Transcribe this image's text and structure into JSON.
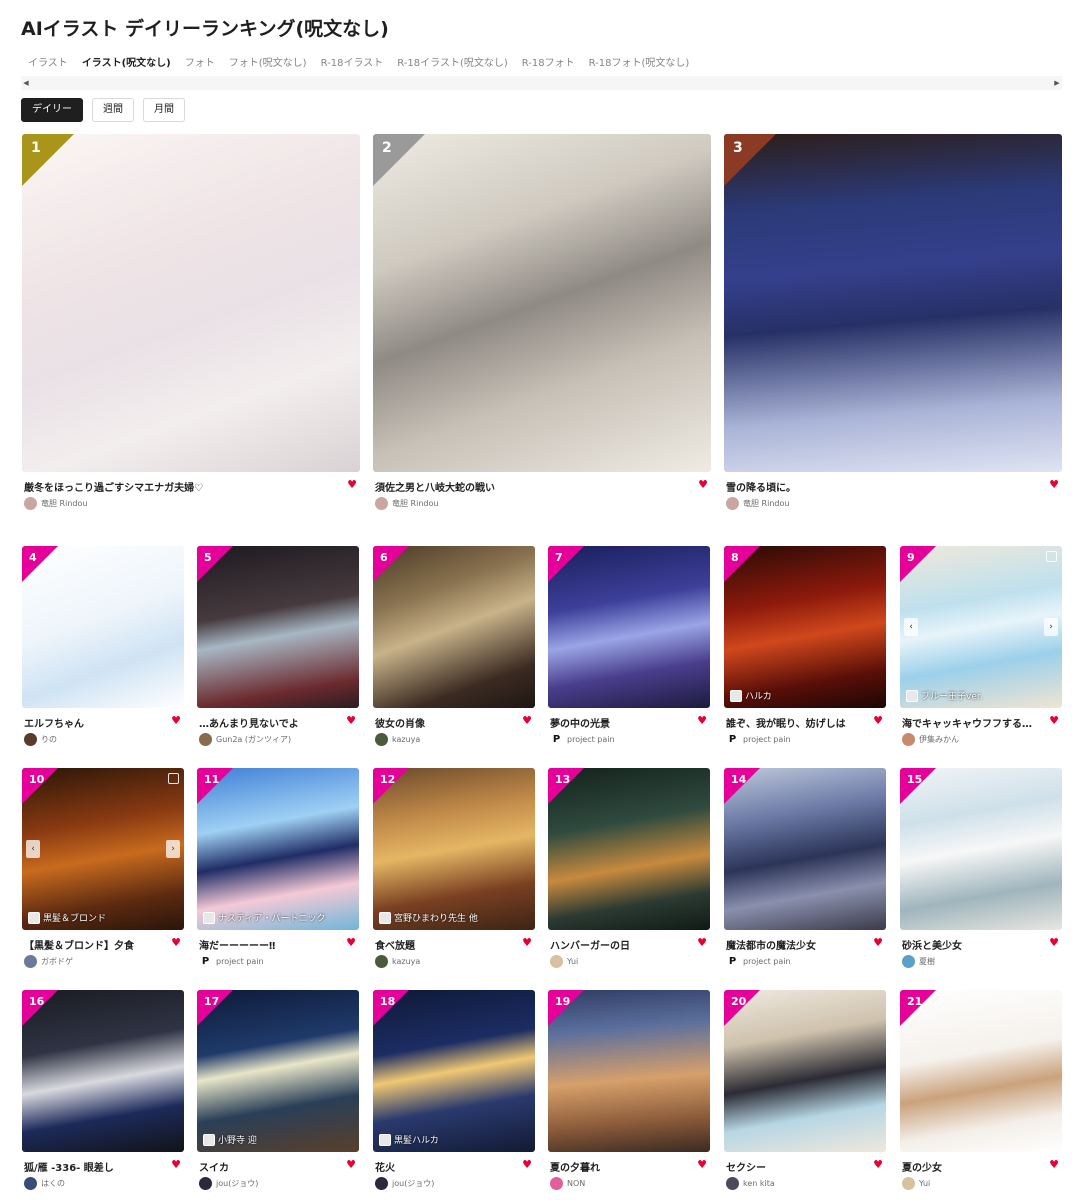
{
  "title": "AIイラスト デイリーランキング(呪文なし)",
  "category_tabs": [
    "イラスト",
    "イラスト(呪文なし)",
    "フォト",
    "フォト(呪文なし)",
    "R-18イラスト",
    "R-18イラスト(呪文なし)",
    "R-18フォト",
    "R-18フォト(呪文なし)"
  ],
  "active_category": 1,
  "scroll_left": "◀",
  "scroll_right": "▶",
  "period_tabs": [
    "デイリー",
    "週間",
    "月間"
  ],
  "active_period": 0,
  "heart_icon": "♥",
  "colors": {
    "heart": "#e60033",
    "rank_gold": "#a8951a",
    "rank_silver": "#9a9a9a",
    "rank_bronze": "#8b3a23",
    "rank_pink": "#e6009a"
  },
  "top3": [
    {
      "rank": "1",
      "title": "厳冬をほっこり過ごすシマエナガ夫婦♡",
      "author": "竜胆 Rindou"
    },
    {
      "rank": "2",
      "title": "須佐之男と八岐大蛇の戦い",
      "author": "竜胆 Rindou"
    },
    {
      "rank": "3",
      "title": "雪の降る頃に。",
      "author": "竜胆 Rindou"
    }
  ],
  "rows": [
    [
      {
        "rank": "4",
        "title": "エルフちゃん",
        "author": "りの"
      },
      {
        "rank": "5",
        "title": "…あんまり見ないでよ",
        "author": "Gun2a (ガンツィア)"
      },
      {
        "rank": "6",
        "title": "彼女の肖像",
        "author": "kazuya"
      },
      {
        "rank": "7",
        "title": "夢の中の光景",
        "author": "project pain"
      },
      {
        "rank": "8",
        "title": "誰ぞ、我が眠り、妨げしは",
        "author": "project pain",
        "overlay": "ハルカ"
      },
      {
        "rank": "9",
        "title": "海でキャッキャウフフする…",
        "author": "伊集みかん",
        "overlay": "ブルー王子ver."
      }
    ],
    [
      {
        "rank": "10",
        "title": "【黒髪＆ブロンド】夕食",
        "author": "ガボドゲ",
        "overlay": "黒髪＆ブロンド"
      },
      {
        "rank": "11",
        "title": "海だーーーーー‼",
        "author": "project pain",
        "overlay": "ナスティア・パートニック"
      },
      {
        "rank": "12",
        "title": "食べ放題",
        "author": "kazuya",
        "overlay": "宮野ひまわり先生 他"
      },
      {
        "rank": "13",
        "title": "ハンバーガーの日",
        "author": "Yui"
      },
      {
        "rank": "14",
        "title": "魔法都市の魔法少女",
        "author": "project pain"
      },
      {
        "rank": "15",
        "title": "砂浜と美少女",
        "author": "夏樹"
      }
    ],
    [
      {
        "rank": "16",
        "title": "狐/雁 -336- 眼差し",
        "author": "はくの"
      },
      {
        "rank": "17",
        "title": "スイカ",
        "author": "jou(ジョウ)",
        "overlay": "小野寺 迎"
      },
      {
        "rank": "18",
        "title": "花火",
        "author": "jou(ジョウ)",
        "overlay": "黒髪ハルカ"
      },
      {
        "rank": "19",
        "title": "夏の夕暮れ",
        "author": "NON"
      },
      {
        "rank": "20",
        "title": "セクシー",
        "author": "ken kita"
      },
      {
        "rank": "21",
        "title": "夏の少女",
        "author": "Yui"
      }
    ]
  ]
}
